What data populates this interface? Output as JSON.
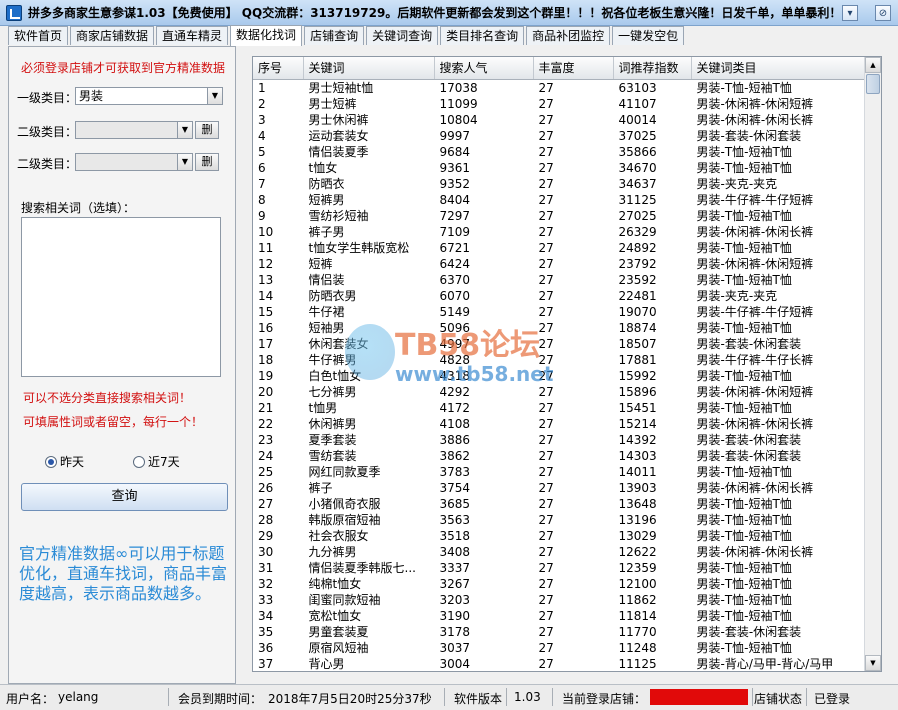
{
  "window": {
    "title": "拼多多商家生意参谋1.03【免费使用】 QQ交流群：313719729。后期软件更新都会发到这个群里！！！祝各位老板生意兴隆！日发千单，单单暴利！",
    "minimize_icon": "minimize-icon",
    "close_icon": "close-icon"
  },
  "tabs": [
    {
      "label": "软件首页",
      "active": false
    },
    {
      "label": "商家店铺数据",
      "active": false
    },
    {
      "label": "直通车精灵",
      "active": false
    },
    {
      "label": "数据化找词",
      "active": true
    },
    {
      "label": "店铺查询",
      "active": false
    },
    {
      "label": "关键词查询",
      "active": false
    },
    {
      "label": "类目排名查询",
      "active": false
    },
    {
      "label": "商品补团监控",
      "active": false
    },
    {
      "label": "一键发空包",
      "active": false
    }
  ],
  "left": {
    "notice": "必须登录店铺才可获取到官方精准数据",
    "cat1_label": "一级类目：",
    "cat1_value": "男装",
    "cat2_label": "二级类目：",
    "cat2_value": "",
    "cat3_label": "二级类目：",
    "cat3_value": "",
    "del_label": "删",
    "keyword_label": "搜索相关词（选填）：",
    "keyword_value": "",
    "note1": "可以不选分类直接搜索相关词！",
    "note2": "可填属性词或者留空，每行一个！",
    "radio_yesterday": "昨天",
    "radio_7days": "近7天",
    "selected_range": "昨天",
    "query_label": "查询",
    "blue_note": "官方精准数据∞可以用于标题优化，直通车找词，商品丰富度越高，表示商品数越多。"
  },
  "table": {
    "columns": [
      "序号",
      "关键词",
      "搜索人气",
      "丰富度",
      "词推荐指数",
      "关键词类目"
    ],
    "rows": [
      [
        "1",
        "男士短袖t恤",
        "17038",
        "27",
        "63103",
        "男装-T恤-短袖T恤"
      ],
      [
        "2",
        "男士短裤",
        "11099",
        "27",
        "41107",
        "男装-休闲裤-休闲短裤"
      ],
      [
        "3",
        "男士休闲裤",
        "10804",
        "27",
        "40014",
        "男装-休闲裤-休闲长裤"
      ],
      [
        "4",
        "运动套装女",
        "9997",
        "27",
        "37025",
        "男装-套装-休闲套装"
      ],
      [
        "5",
        "情侣装夏季",
        "9684",
        "27",
        "35866",
        "男装-T恤-短袖T恤"
      ],
      [
        "6",
        "t恤女",
        "9361",
        "27",
        "34670",
        "男装-T恤-短袖T恤"
      ],
      [
        "7",
        "防晒衣",
        "9352",
        "27",
        "34637",
        "男装-夹克-夹克"
      ],
      [
        "8",
        "短裤男",
        "8404",
        "27",
        "31125",
        "男装-牛仔裤-牛仔短裤"
      ],
      [
        "9",
        "雪纺衫短袖",
        "7297",
        "27",
        "27025",
        "男装-T恤-短袖T恤"
      ],
      [
        "10",
        "裤子男",
        "7109",
        "27",
        "26329",
        "男装-休闲裤-休闲长裤"
      ],
      [
        "11",
        "t恤女学生韩版宽松",
        "6721",
        "27",
        "24892",
        "男装-T恤-短袖T恤"
      ],
      [
        "12",
        "短裤",
        "6424",
        "27",
        "23792",
        "男装-休闲裤-休闲短裤"
      ],
      [
        "13",
        "情侣装",
        "6370",
        "27",
        "23592",
        "男装-T恤-短袖T恤"
      ],
      [
        "14",
        "防晒衣男",
        "6070",
        "27",
        "22481",
        "男装-夹克-夹克"
      ],
      [
        "15",
        "牛仔裙",
        "5149",
        "27",
        "19070",
        "男装-牛仔裤-牛仔短裤"
      ],
      [
        "16",
        "短袖男",
        "5096",
        "27",
        "18874",
        "男装-T恤-短袖T恤"
      ],
      [
        "17",
        "休闲套装女",
        "4997",
        "27",
        "18507",
        "男装-套装-休闲套装"
      ],
      [
        "18",
        "牛仔裤男",
        "4828",
        "27",
        "17881",
        "男装-牛仔裤-牛仔长裤"
      ],
      [
        "19",
        "白色t恤女",
        "4318",
        "27",
        "15992",
        "男装-T恤-短袖T恤"
      ],
      [
        "20",
        "七分裤男",
        "4292",
        "27",
        "15896",
        "男装-休闲裤-休闲短裤"
      ],
      [
        "21",
        "t恤男",
        "4172",
        "27",
        "15451",
        "男装-T恤-短袖T恤"
      ],
      [
        "22",
        "休闲裤男",
        "4108",
        "27",
        "15214",
        "男装-休闲裤-休闲长裤"
      ],
      [
        "23",
        "夏季套装",
        "3886",
        "27",
        "14392",
        "男装-套装-休闲套装"
      ],
      [
        "24",
        "雪纺套装",
        "3862",
        "27",
        "14303",
        "男装-套装-休闲套装"
      ],
      [
        "25",
        "网红同款夏季",
        "3783",
        "27",
        "14011",
        "男装-T恤-短袖T恤"
      ],
      [
        "26",
        "裤子",
        "3754",
        "27",
        "13903",
        "男装-休闲裤-休闲长裤"
      ],
      [
        "27",
        "小猪佩奇衣服",
        "3685",
        "27",
        "13648",
        "男装-T恤-短袖T恤"
      ],
      [
        "28",
        "韩版原宿短袖",
        "3563",
        "27",
        "13196",
        "男装-T恤-短袖T恤"
      ],
      [
        "29",
        "社会衣服女",
        "3518",
        "27",
        "13029",
        "男装-T恤-短袖T恤"
      ],
      [
        "30",
        "九分裤男",
        "3408",
        "27",
        "12622",
        "男装-休闲裤-休闲长裤"
      ],
      [
        "31",
        "情侣装夏季韩版七...",
        "3337",
        "27",
        "12359",
        "男装-T恤-短袖T恤"
      ],
      [
        "32",
        "纯棉t恤女",
        "3267",
        "27",
        "12100",
        "男装-T恤-短袖T恤"
      ],
      [
        "33",
        "闺蜜同款短袖",
        "3203",
        "27",
        "11862",
        "男装-T恤-短袖T恤"
      ],
      [
        "34",
        "宽松t恤女",
        "3190",
        "27",
        "11814",
        "男装-T恤-短袖T恤"
      ],
      [
        "35",
        "男童套装夏",
        "3178",
        "27",
        "11770",
        "男装-套装-休闲套装"
      ],
      [
        "36",
        "原宿风短袖",
        "3037",
        "27",
        "11248",
        "男装-T恤-短袖T恤"
      ],
      [
        "37",
        "背心男",
        "3004",
        "27",
        "11125",
        "男装-背心/马甲-背心/马甲"
      ]
    ]
  },
  "watermark": {
    "line1": "TB58论坛",
    "line2": "www.tb58.net"
  },
  "status": {
    "user_label": "用户名：",
    "user_value": "yelang",
    "expire_label": "会员到期时间：",
    "expire_value": "2018年7月5日20时25分37秒",
    "version_label": "软件版本",
    "version_value": "1.03",
    "store_label": "当前登录店铺：",
    "store_state_label": "店铺状态",
    "store_state_value": "已登录"
  }
}
